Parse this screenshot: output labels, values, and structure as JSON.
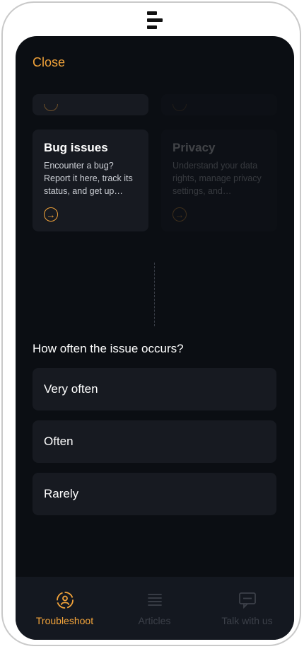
{
  "close_label": "Close",
  "cards": [
    {
      "title": "Bug issues",
      "description": "Encounter a bug? Report it here, track its status, and get up…"
    },
    {
      "title": "Privacy",
      "description": "Understand your data rights, manage privacy settings, and…"
    }
  ],
  "question": "How often the issue occurs?",
  "options": [
    "Very often",
    "Often",
    "Rarely"
  ],
  "nav": [
    {
      "label": "Troubleshoot",
      "icon": "troubleshoot-icon",
      "active": true
    },
    {
      "label": "Articles",
      "icon": "articles-icon",
      "active": false
    },
    {
      "label": "Talk with us",
      "icon": "chat-icon",
      "active": false
    }
  ],
  "colors": {
    "accent": "#f2a33a",
    "background": "#0b0e13",
    "card": "#171a21"
  }
}
